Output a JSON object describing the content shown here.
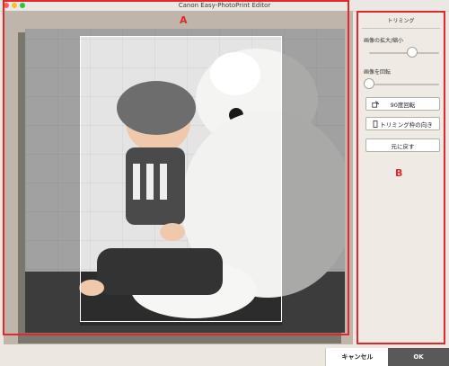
{
  "window": {
    "title": "Canon Easy-PhotoPrint Editor"
  },
  "markers": {
    "a": "A",
    "b": "B"
  },
  "panel": {
    "header": "トリミング",
    "zoom": {
      "label": "画像の拡大/縮小",
      "value": 0.62
    },
    "rotate": {
      "label": "画像を回転",
      "value": 0.0
    },
    "buttons": {
      "rotate90": "90度回転",
      "frame_orientation": "トリミング枠の向き",
      "reset": "元に戻す"
    }
  },
  "footer": {
    "cancel": "キャンセル",
    "ok": "OK"
  },
  "colors": {
    "accent_red": "#e2282c",
    "ok_bg": "#595959"
  }
}
